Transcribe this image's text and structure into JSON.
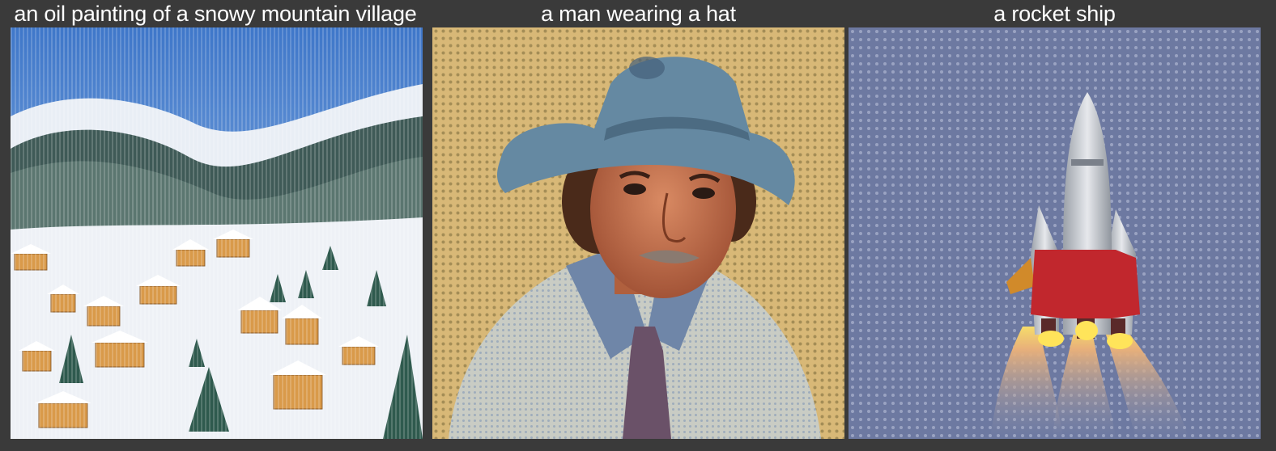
{
  "panels": [
    {
      "caption": "an oil painting of a snowy mountain village",
      "image_subject": "snowy-mountain-village-painting"
    },
    {
      "caption": "a man wearing a hat",
      "image_subject": "man-wearing-hat-portrait"
    },
    {
      "caption": "a rocket ship",
      "image_subject": "rocket-ship-illustration"
    }
  ],
  "colors": {
    "page_background": "#3a3a3a",
    "caption_text": "#ffffff"
  }
}
